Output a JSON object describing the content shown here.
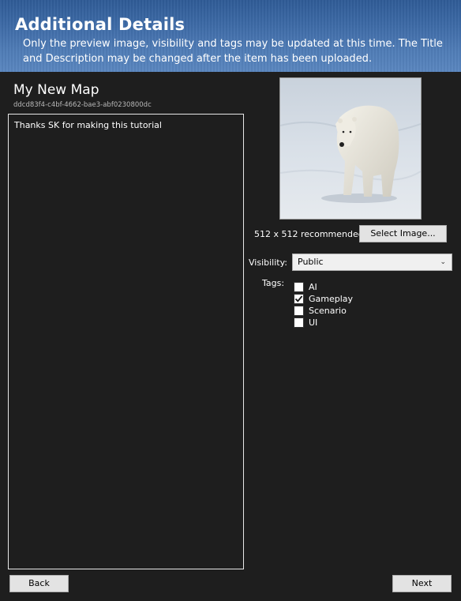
{
  "header": {
    "title": "Additional Details",
    "description": "Only the preview image, visibility and tags may be updated at this time.  The Title and Description may be changed after the item has been uploaded."
  },
  "item": {
    "name": "My New Map",
    "id": "ddcd83f4-c4bf-4662-bae3-abf0230800dc",
    "description": "Thanks SK for making this tutorial"
  },
  "preview": {
    "image_icon": "polar-bear-photo",
    "recommended_label": "512 x 512 recommended",
    "select_button_label": "Select Image..."
  },
  "visibility": {
    "label": "Visibility:",
    "selected": "Public"
  },
  "tags": {
    "label": "Tags:",
    "items": [
      {
        "label": "AI",
        "checked": false
      },
      {
        "label": "Gameplay",
        "checked": true
      },
      {
        "label": "Scenario",
        "checked": false
      },
      {
        "label": "UI",
        "checked": false
      }
    ]
  },
  "nav": {
    "back_label": "Back",
    "next_label": "Next"
  },
  "colors": {
    "background": "#1e1e1e",
    "header_blue": "#3d6aa6",
    "button_face": "#e3e3e3"
  }
}
